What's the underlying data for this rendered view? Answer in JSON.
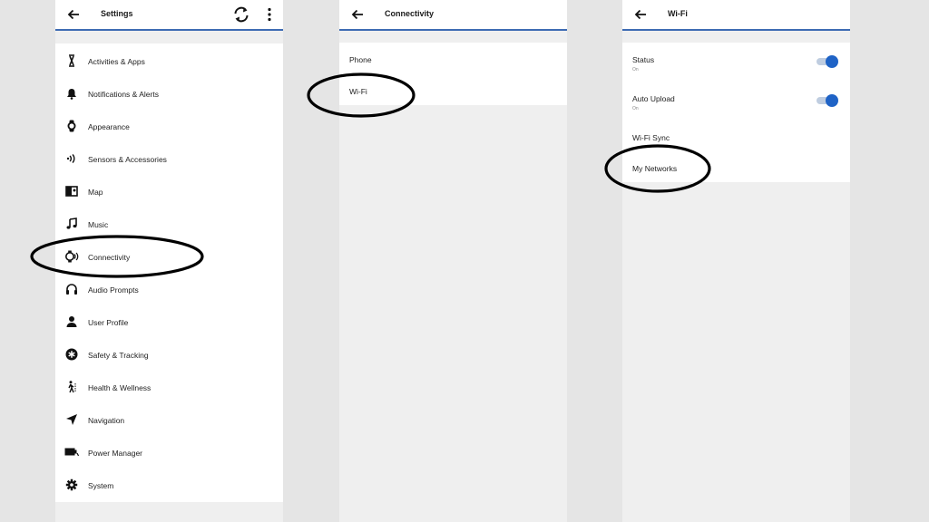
{
  "colors": {
    "accent": "#3d6bb3",
    "toggle_on": "#1f63c6",
    "panel_bg": "#efefef"
  },
  "settings": {
    "title": "Settings",
    "items": [
      {
        "label": "Activities & Apps",
        "icon": "runner-icon"
      },
      {
        "label": "Notifications & Alerts",
        "icon": "bell-icon"
      },
      {
        "label": "Appearance",
        "icon": "watch-icon"
      },
      {
        "label": "Sensors & Accessories",
        "icon": "sensor-icon"
      },
      {
        "label": "Map",
        "icon": "map-icon"
      },
      {
        "label": "Music",
        "icon": "music-note-icon"
      },
      {
        "label": "Connectivity",
        "icon": "watch-signal-icon"
      },
      {
        "label": "Audio Prompts",
        "icon": "headphones-icon"
      },
      {
        "label": "User Profile",
        "icon": "person-icon"
      },
      {
        "label": "Safety & Tracking",
        "icon": "asterisk-icon"
      },
      {
        "label": "Health & Wellness",
        "icon": "walker-icon"
      },
      {
        "label": "Navigation",
        "icon": "navigation-arrow-icon"
      },
      {
        "label": "Power Manager",
        "icon": "battery-icon"
      },
      {
        "label": "System",
        "icon": "gear-icon"
      }
    ]
  },
  "connectivity": {
    "title": "Connectivity",
    "items": [
      {
        "label": "Phone"
      },
      {
        "label": "Wi-Fi"
      }
    ]
  },
  "wifi": {
    "title": "Wi-Fi",
    "status": {
      "label": "Status",
      "sub": "On",
      "on": true
    },
    "auto_upload": {
      "label": "Auto Upload",
      "sub": "On",
      "on": true
    },
    "sync": {
      "label": "Wi-Fi Sync"
    },
    "networks": {
      "label": "My Networks"
    }
  }
}
